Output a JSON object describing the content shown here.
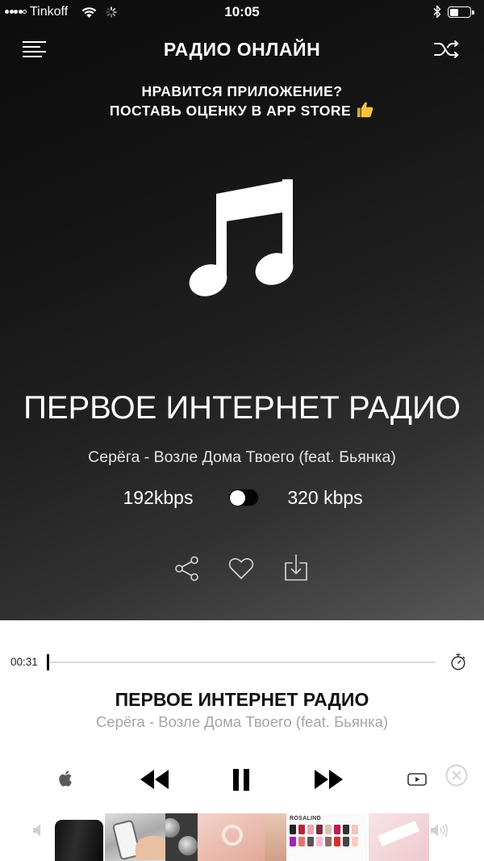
{
  "status_bar": {
    "carrier": "Tinkoff",
    "time": "10:05",
    "battery_level": 0.45,
    "icons": {
      "signal": "signal-dots-icon",
      "wifi": "wifi-icon",
      "activity": "activity-spinner-icon",
      "bluetooth": "bluetooth-icon",
      "battery": "battery-icon"
    }
  },
  "header": {
    "title": "РАДИО ОНЛАЙН",
    "menu_icon": "hamburger-menu-icon",
    "shuffle_icon": "shuffle-icon"
  },
  "promo": {
    "line1": "НРАВИТСЯ ПРИЛОЖЕНИЕ?",
    "line2": "ПОСТАВЬ ОЦЕНКУ В APP STORE",
    "icon": "thumbs-up-icon"
  },
  "now_playing": {
    "artwork_icon": "music-note-icon",
    "station": "ПЕРВОЕ ИНТЕРНЕТ РАДИО",
    "track": "Серёга - Возле Дома Твоего (feat. Бьянка)",
    "bitrate_low": "192kbps",
    "bitrate_high": "320 kbps",
    "high_quality_enabled": false,
    "actions": [
      {
        "icon": "share-icon"
      },
      {
        "icon": "heart-icon"
      },
      {
        "icon": "download-icon"
      }
    ]
  },
  "player": {
    "elapsed": "00:31",
    "progress": 0,
    "timer_icon": "sleep-timer-icon",
    "station": "ПЕРВОЕ ИНТЕРНЕТ РАДИО",
    "track": "Серёга - Возле Дома Твоего (feat. Бьянка)",
    "controls": {
      "apple_music": "apple-icon",
      "previous": "rewind-icon",
      "play_pause": "pause-icon",
      "next": "fast-forward-icon",
      "youtube": "youtube-icon"
    },
    "volume_icons": {
      "min": "volume-mute-icon",
      "max": "volume-max-icon"
    }
  },
  "ad_banner": {
    "close_icon": "close-circle-icon",
    "brand_text": "ROSALIND"
  },
  "colors": {
    "hero_dark": "#0c0c0c",
    "hero_light": "#575757",
    "hero_text": "#ffffff",
    "player_text": "#111111",
    "player_secondary": "#a5a5a5",
    "thumbs_up": "#f7c541"
  }
}
